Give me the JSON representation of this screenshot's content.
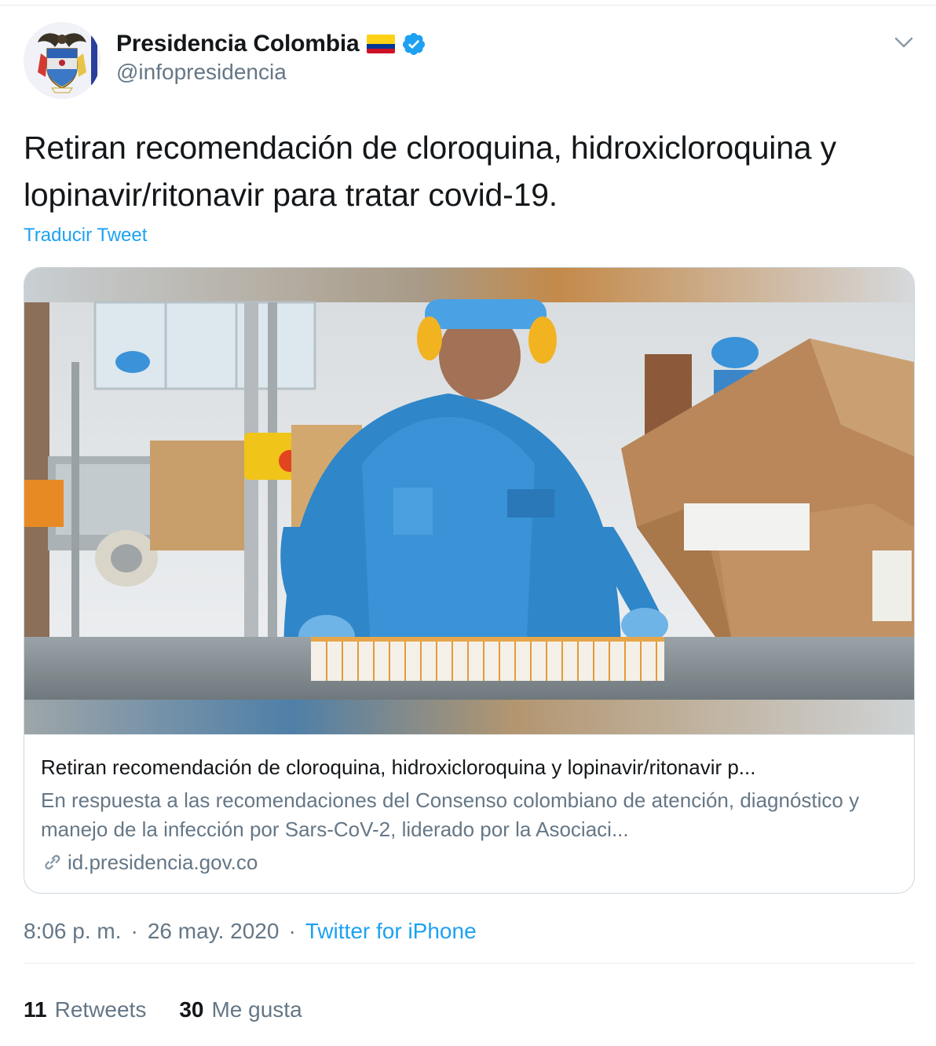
{
  "colors": {
    "text_primary": "#14171a",
    "text_secondary": "#657786",
    "link_blue": "#1da1f2",
    "border": "#ccd6dd",
    "verified_badge": "#1da1f2"
  },
  "icons": {
    "avatar": "colombia-coat-of-arms",
    "flag": "colombia-flag-icon",
    "verified": "verified-badge-icon",
    "menu": "chevron-down-icon",
    "link": "link-icon"
  },
  "author": {
    "display_name": "Presidencia Colombia",
    "handle": "@infopresidencia"
  },
  "tweet": {
    "text": "Retiran recomendación de cloroquina, hidroxicloroquina y lopinavir/ritonavir para tratar covid-19.",
    "translate_label": "Traducir Tweet"
  },
  "card": {
    "title": "Retiran recomendación de cloroquina, hidroxicloroquina y lopinavir/ritonavir p...",
    "description": "En respuesta a las recomendaciones del Consenso colombiano de atención, diagnóstico y manejo de la infección por Sars-CoV-2, liderado por la Asociaci...",
    "domain": "id.presidencia.gov.co"
  },
  "meta": {
    "time": "8:06 p. m.",
    "separator": "·",
    "date": "26 may. 2020",
    "source": "Twitter for iPhone"
  },
  "stats": {
    "retweets_count": "11",
    "retweets_label": "Retweets",
    "likes_count": "30",
    "likes_label": "Me gusta"
  }
}
